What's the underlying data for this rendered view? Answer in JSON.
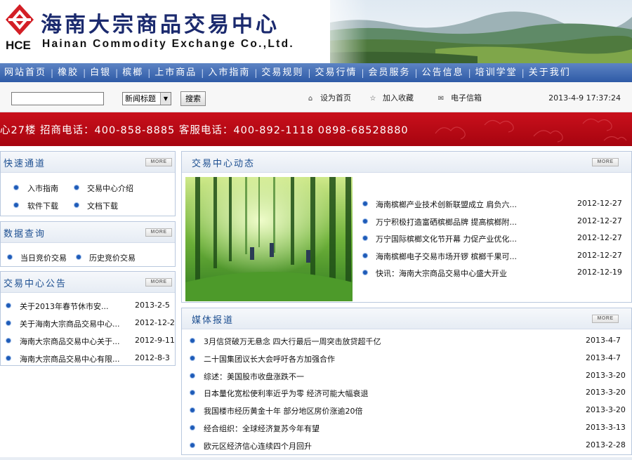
{
  "header": {
    "logo_cn": "海南大宗商品交易中心",
    "logo_abbr": "HCE",
    "logo_en": "Hainan Commodity Exchange Co.,Ltd."
  },
  "nav": [
    "网站首页",
    "橡胶",
    "白银",
    "槟榔",
    "上市商品",
    "入市指南",
    "交易规则",
    "交易行情",
    "会员服务",
    "公告信息",
    "培训学堂",
    "关于我们"
  ],
  "search": {
    "input_value": "",
    "select_value": "新闻标题",
    "button_label": "搜索"
  },
  "toolbar": {
    "set_home": "设为首页",
    "add_favorite": "加入收藏",
    "email": "电子信箱",
    "datetime": "2013-4-9 17:37:24"
  },
  "red_banner": {
    "text": "心27楼   招商电话：400-858-8885   客服电话：400-892-1118   0898-68528880"
  },
  "more_label": "MORE",
  "quick": {
    "title": "快速通道",
    "items": [
      "入市指南",
      "交易中心介绍",
      "软件下载",
      "文档下载"
    ]
  },
  "data_query": {
    "title": "数据查询",
    "items": [
      "当日竞价交易",
      "历史竞价交易"
    ]
  },
  "notices": {
    "title": "交易中心公告",
    "rows": [
      {
        "text": "关于2013年春节休市安...",
        "date": "2013-2-5"
      },
      {
        "text": "关于海南大宗商品交易中心...",
        "date": "2012-12-2"
      },
      {
        "text": "海南大宗商品交易中心关于...",
        "date": "2012-9-11"
      },
      {
        "text": "海南大宗商品交易中心有限...",
        "date": "2012-8-3"
      }
    ]
  },
  "news": {
    "title": "交易中心动态",
    "rows": [
      {
        "text": "海南槟榔产业技术创新联盟成立 肩负六...",
        "date": "2012-12-27"
      },
      {
        "text": "万宁积极打造富硒槟榔品牌 提高槟榔附...",
        "date": "2012-12-27"
      },
      {
        "text": "万宁国际槟榔文化节开幕 力促产业优化...",
        "date": "2012-12-27"
      },
      {
        "text": "海南槟榔电子交易市场开锣 槟榔千果可...",
        "date": "2012-12-27"
      },
      {
        "text": "快讯：海南大宗商品交易中心盛大开业",
        "date": "2012-12-19"
      }
    ]
  },
  "media": {
    "title": "媒体报道",
    "rows": [
      {
        "text": "3月信贷破万无悬念 四大行最后一周突击放贷超千亿",
        "date": "2013-4-7"
      },
      {
        "text": "二十国集团议长大会呼吁各方加强合作",
        "date": "2013-4-7"
      },
      {
        "text": "综述：美国股市收盘涨跌不一",
        "date": "2013-3-20"
      },
      {
        "text": "日本量化宽松使利率近乎为零 经济可能大幅衰退",
        "date": "2013-3-20"
      },
      {
        "text": "我国楼市经历黄金十年 部分地区房价涨逾20倍",
        "date": "2013-3-20"
      },
      {
        "text": "经合组织：全球经济复苏今年有望",
        "date": "2013-3-13"
      },
      {
        "text": "欧元区经济信心连续四个月回升",
        "date": "2013-2-28"
      }
    ]
  },
  "colors": {
    "nav_blue": "#2e5aa6",
    "banner_red": "#b8081a",
    "panel_title": "#1d4f91",
    "bullet": "#1e5bb8",
    "logo_red": "#d31f26",
    "logo_navy": "#1b2a6e"
  },
  "icons": [
    "logo-mark",
    "home-icon",
    "favorite-icon",
    "email-icon",
    "dropdown-arrow-icon",
    "bullet-icon"
  ]
}
